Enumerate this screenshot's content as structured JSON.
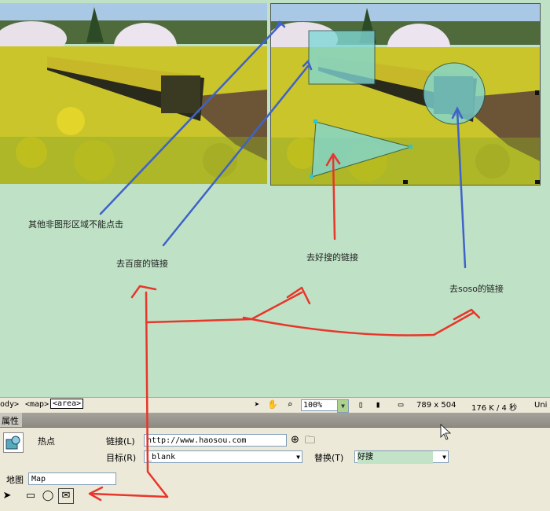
{
  "annotations": {
    "non_shape_area": "其他非图形区域不能点击",
    "to_baidu": "去百度的链接",
    "to_haosou": "去好搜的链接",
    "to_soso": "去soso的链接"
  },
  "status_bar": {
    "tags": [
      "ody>",
      "<map>",
      "<area>"
    ],
    "zoom": "100%",
    "dimensions": "789 x 504",
    "filesize": "176 K / 4 秒",
    "encoding": "Uni"
  },
  "panel": {
    "title": "属性"
  },
  "properties": {
    "type_label": "热点",
    "link_label": "链接(L)",
    "link_value": "http://www.haosou.com",
    "target_label": "目标(R)",
    "target_value": "_blank",
    "alt_label": "替换(T)",
    "alt_value": "好搜",
    "map_label": "地图",
    "map_value": "Map"
  },
  "colors": {
    "canvas": "#bfe2c6",
    "hotspot_fill": "#7fd8d8",
    "arrow_blue": "#3f62c9",
    "arrow_red": "#e8362b"
  }
}
